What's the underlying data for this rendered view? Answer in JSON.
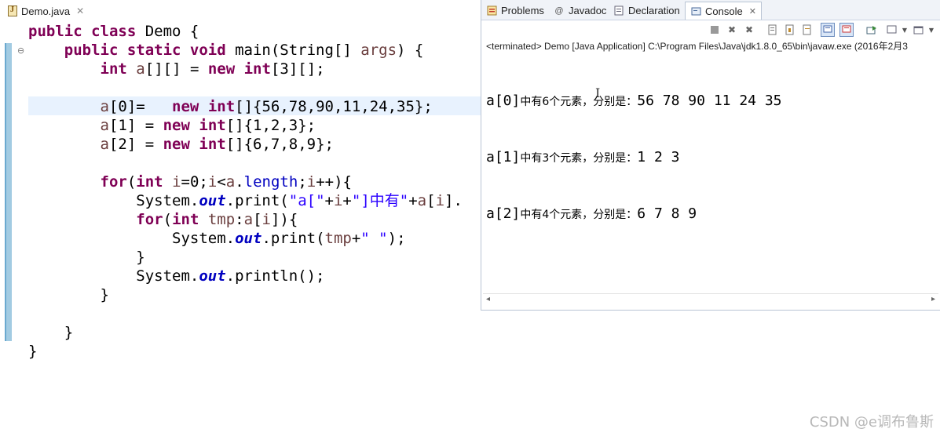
{
  "editor": {
    "tab": {
      "label": "Demo.java",
      "close": "✕"
    },
    "lines": [
      [
        {
          "t": "public class",
          "c": "kw"
        },
        {
          "t": " Demo {"
        }
      ],
      [
        {
          "t": "    "
        },
        {
          "t": "public static void",
          "c": "kw"
        },
        {
          "t": " main(String[] "
        },
        {
          "t": "args",
          "c": "var"
        },
        {
          "t": ") {"
        }
      ],
      [
        {
          "t": "        "
        },
        {
          "t": "int",
          "c": "kw"
        },
        {
          "t": " "
        },
        {
          "t": "a",
          "c": "var"
        },
        {
          "t": "[][] = "
        },
        {
          "t": "new",
          "c": "kw"
        },
        {
          "t": " "
        },
        {
          "t": "int",
          "c": "kw"
        },
        {
          "t": "[3][];"
        }
      ],
      [
        {
          "t": ""
        }
      ],
      [
        {
          "t": "        "
        },
        {
          "t": "a",
          "c": "var"
        },
        {
          "t": "[0]=   "
        },
        {
          "t": "new",
          "c": "kw"
        },
        {
          "t": " "
        },
        {
          "t": "int",
          "c": "kw"
        },
        {
          "t": "[]{56,78,90,11,24,35};"
        }
      ],
      [
        {
          "t": "        "
        },
        {
          "t": "a",
          "c": "var"
        },
        {
          "t": "[1] = "
        },
        {
          "t": "new",
          "c": "kw"
        },
        {
          "t": " "
        },
        {
          "t": "int",
          "c": "kw"
        },
        {
          "t": "[]{1,2,3};"
        }
      ],
      [
        {
          "t": "        "
        },
        {
          "t": "a",
          "c": "var"
        },
        {
          "t": "[2] = "
        },
        {
          "t": "new",
          "c": "kw"
        },
        {
          "t": " "
        },
        {
          "t": "int",
          "c": "kw"
        },
        {
          "t": "[]{6,7,8,9};"
        }
      ],
      [
        {
          "t": ""
        }
      ],
      [
        {
          "t": "        "
        },
        {
          "t": "for",
          "c": "kw"
        },
        {
          "t": "("
        },
        {
          "t": "int",
          "c": "kw"
        },
        {
          "t": " "
        },
        {
          "t": "i",
          "c": "var"
        },
        {
          "t": "=0;"
        },
        {
          "t": "i",
          "c": "var"
        },
        {
          "t": "<"
        },
        {
          "t": "a",
          "c": "var"
        },
        {
          "t": "."
        },
        {
          "t": "length",
          "c": "fld2"
        },
        {
          "t": ";"
        },
        {
          "t": "i",
          "c": "var"
        },
        {
          "t": "++){"
        }
      ],
      [
        {
          "t": "            System."
        },
        {
          "t": "out",
          "c": "fld"
        },
        {
          "t": ".print("
        },
        {
          "t": "\"a[\"",
          "c": "str"
        },
        {
          "t": "+"
        },
        {
          "t": "i",
          "c": "var"
        },
        {
          "t": "+"
        },
        {
          "t": "\"]中有\"",
          "c": "str"
        },
        {
          "t": "+"
        },
        {
          "t": "a",
          "c": "var"
        },
        {
          "t": "["
        },
        {
          "t": "i",
          "c": "var"
        },
        {
          "t": "]."
        }
      ],
      [
        {
          "t": "            "
        },
        {
          "t": "for",
          "c": "kw"
        },
        {
          "t": "("
        },
        {
          "t": "int",
          "c": "kw"
        },
        {
          "t": " "
        },
        {
          "t": "tmp",
          "c": "var"
        },
        {
          "t": ":"
        },
        {
          "t": "a",
          "c": "var"
        },
        {
          "t": "["
        },
        {
          "t": "i",
          "c": "var"
        },
        {
          "t": "]){"
        }
      ],
      [
        {
          "t": "                System."
        },
        {
          "t": "out",
          "c": "fld"
        },
        {
          "t": ".print("
        },
        {
          "t": "tmp",
          "c": "var"
        },
        {
          "t": "+"
        },
        {
          "t": "\" \"",
          "c": "str"
        },
        {
          "t": ");"
        }
      ],
      [
        {
          "t": "            }"
        }
      ],
      [
        {
          "t": "            System."
        },
        {
          "t": "out",
          "c": "fld"
        },
        {
          "t": ".println();"
        }
      ],
      [
        {
          "t": "        }"
        }
      ],
      [
        {
          "t": ""
        }
      ],
      [
        {
          "t": "    }"
        }
      ],
      [
        {
          "t": "}"
        }
      ]
    ]
  },
  "views": {
    "tabs": [
      {
        "label": "Problems",
        "icon": "problems-icon"
      },
      {
        "label": "Javadoc",
        "icon": "javadoc-icon"
      },
      {
        "label": "Declaration",
        "icon": "declaration-icon"
      },
      {
        "label": "Console",
        "icon": "console-icon",
        "active": true,
        "close": "✕"
      }
    ]
  },
  "console": {
    "status": "<terminated> Demo [Java Application] C:\\Program Files\\Java\\jdk1.8.0_65\\bin\\javaw.exe (2016年2月3",
    "output": [
      {
        "prefix": "a[0]",
        "cn": "中有6个元素，分别是：",
        "values": "56 78 90 11 24 35"
      },
      {
        "prefix": "a[1]",
        "cn": "中有3个元素，分别是：",
        "values": "1 2 3"
      },
      {
        "prefix": "a[2]",
        "cn": "中有4个元素，分别是：",
        "values": "6 7 8 9"
      }
    ]
  },
  "watermark": "CSDN @e调布鲁斯"
}
